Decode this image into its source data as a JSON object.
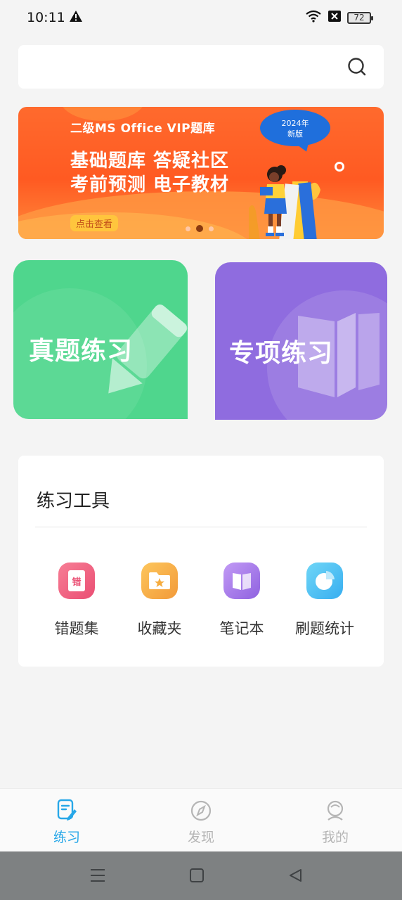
{
  "status_bar": {
    "time": "10:11",
    "battery": "72",
    "icons": [
      "warning-icon",
      "wifi-icon",
      "no-sim-icon",
      "battery-icon"
    ]
  },
  "search": {
    "placeholder": "",
    "icon": "search-icon"
  },
  "banner": {
    "subtitle": "二级MS  Office  VIP题库",
    "line1": "基础题库  答疑社区",
    "line2": "考前预测  电子教材",
    "badge_line1": "2024年",
    "badge_line2": "新版",
    "cta": "点击查看",
    "pages": 3,
    "active_page": 2,
    "colors": {
      "bg": "#ff5a22",
      "badge": "#1f6fdc",
      "cta_bg": "#ffc53d"
    }
  },
  "practice_cards": [
    {
      "label": "真题练习",
      "icon": "pencil-icon",
      "color": "#4fd68d"
    },
    {
      "label": "专项练习",
      "icon": "book-icon",
      "color": "#8f6cdf"
    }
  ],
  "tools": {
    "title": "练习工具",
    "items": [
      {
        "label": "错题集",
        "icon": "mistakes-icon",
        "glyph": "错",
        "color": "#f0607e"
      },
      {
        "label": "收藏夹",
        "icon": "favorites-folder-icon",
        "color": "#fbb447"
      },
      {
        "label": "笔记本",
        "icon": "notebook-icon",
        "color": "#a77ae6"
      },
      {
        "label": "刷题统计",
        "icon": "statistics-icon",
        "color": "#4bc3f2"
      }
    ]
  },
  "bottom_nav": {
    "items": [
      {
        "label": "练习",
        "icon": "practice-icon",
        "active": true
      },
      {
        "label": "发现",
        "icon": "compass-icon",
        "active": false
      },
      {
        "label": "我的",
        "icon": "profile-icon",
        "active": false
      }
    ],
    "active_color": "#27a7e8",
    "inactive_color": "#b5b5b5"
  },
  "system_nav": [
    "menu-icon",
    "home-icon",
    "back-icon"
  ]
}
